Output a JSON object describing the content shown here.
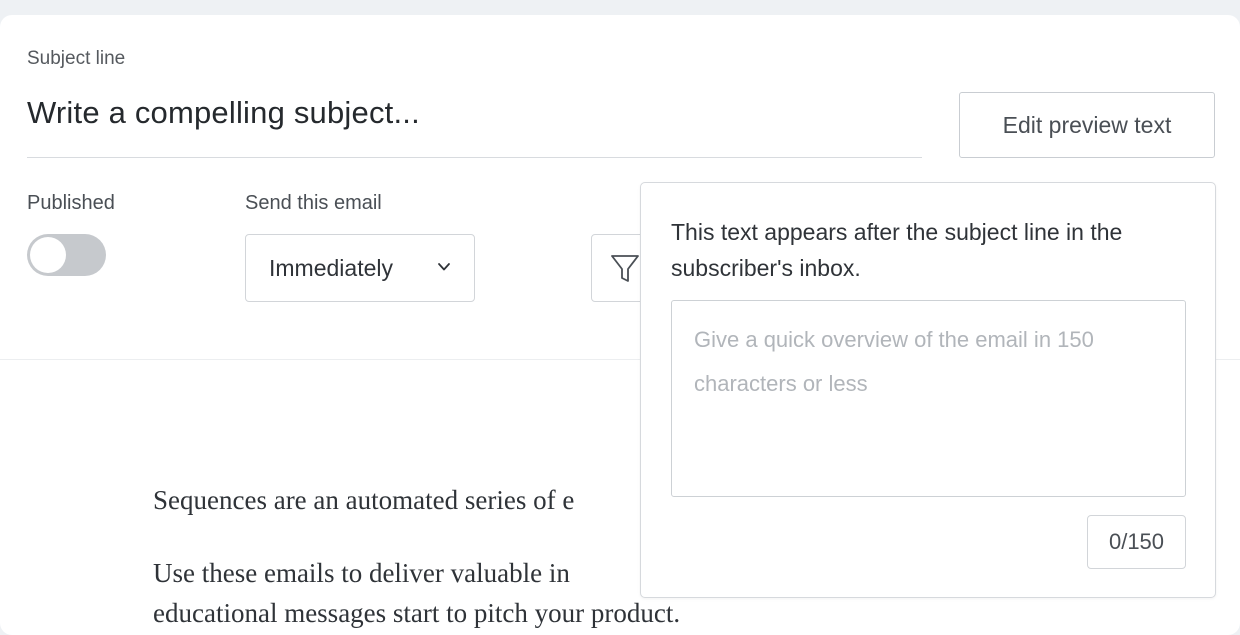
{
  "subject": {
    "label": "Subject line",
    "value": "Write a compelling subject..."
  },
  "edit_preview_button": "Edit preview text",
  "published": {
    "label": "Published",
    "toggle_on": false
  },
  "send": {
    "label": "Send this email",
    "selected": "Immediately"
  },
  "body": {
    "line1": "Sequences are an automated series of e",
    "line2": "Use these emails to deliver valuable in",
    "line3": "educational messages start to pitch your product."
  },
  "preview_popover": {
    "description": "This text appears after the subject line in the subscriber's inbox.",
    "placeholder": "Give a quick overview of the email in 150 characters or less",
    "value": "",
    "counter": "0/150"
  },
  "icons": {
    "select_chevron": "chevron-down-icon",
    "filter": "filter-icon"
  },
  "colors": {
    "toggle_off": "#c6c9cd",
    "border": "#d2d5d9",
    "text": "#2f3338"
  }
}
